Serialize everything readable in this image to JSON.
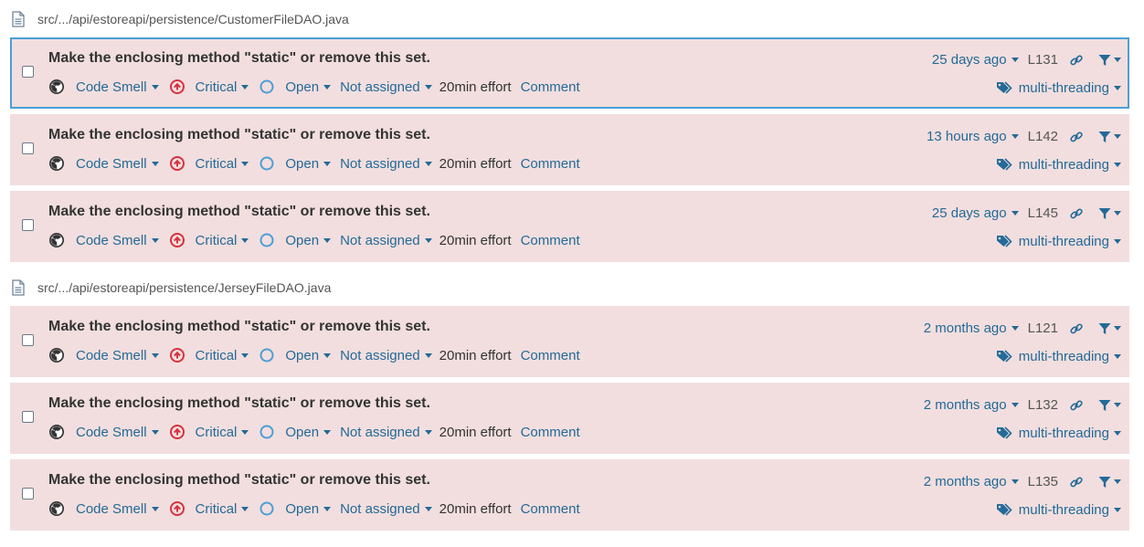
{
  "files": [
    {
      "path": "src/.../api/estoreapi/persistence/CustomerFileDAO.java",
      "issues": [
        {
          "message": "Make the enclosing method \"static\" or remove this set.",
          "date": "25 days ago",
          "line": "L131",
          "selected": true
        },
        {
          "message": "Make the enclosing method \"static\" or remove this set.",
          "date": "13 hours ago",
          "line": "L142",
          "selected": false
        },
        {
          "message": "Make the enclosing method \"static\" or remove this set.",
          "date": "25 days ago",
          "line": "L145",
          "selected": false
        }
      ]
    },
    {
      "path": "src/.../api/estoreapi/persistence/JerseyFileDAO.java",
      "issues": [
        {
          "message": "Make the enclosing method \"static\" or remove this set.",
          "date": "2 months ago",
          "line": "L121",
          "selected": false
        },
        {
          "message": "Make the enclosing method \"static\" or remove this set.",
          "date": "2 months ago",
          "line": "L132",
          "selected": false
        },
        {
          "message": "Make the enclosing method \"static\" or remove this set.",
          "date": "2 months ago",
          "line": "L135",
          "selected": false
        }
      ]
    }
  ],
  "labels": {
    "type": "Code Smell",
    "severity": "Critical",
    "status": "Open",
    "assignee": "Not assigned",
    "effort": "20min effort",
    "comment": "Comment",
    "tag": "multi-threading"
  },
  "colors": {
    "issue_bg": "#f2dede",
    "link": "#236a97",
    "critical": "#d4333f",
    "selected_border": "#4b9fd5"
  },
  "icons": [
    "file-icon",
    "code-smell-icon",
    "critical-severity-icon",
    "open-status-icon",
    "link-icon",
    "filter-icon",
    "tag-icon"
  ]
}
